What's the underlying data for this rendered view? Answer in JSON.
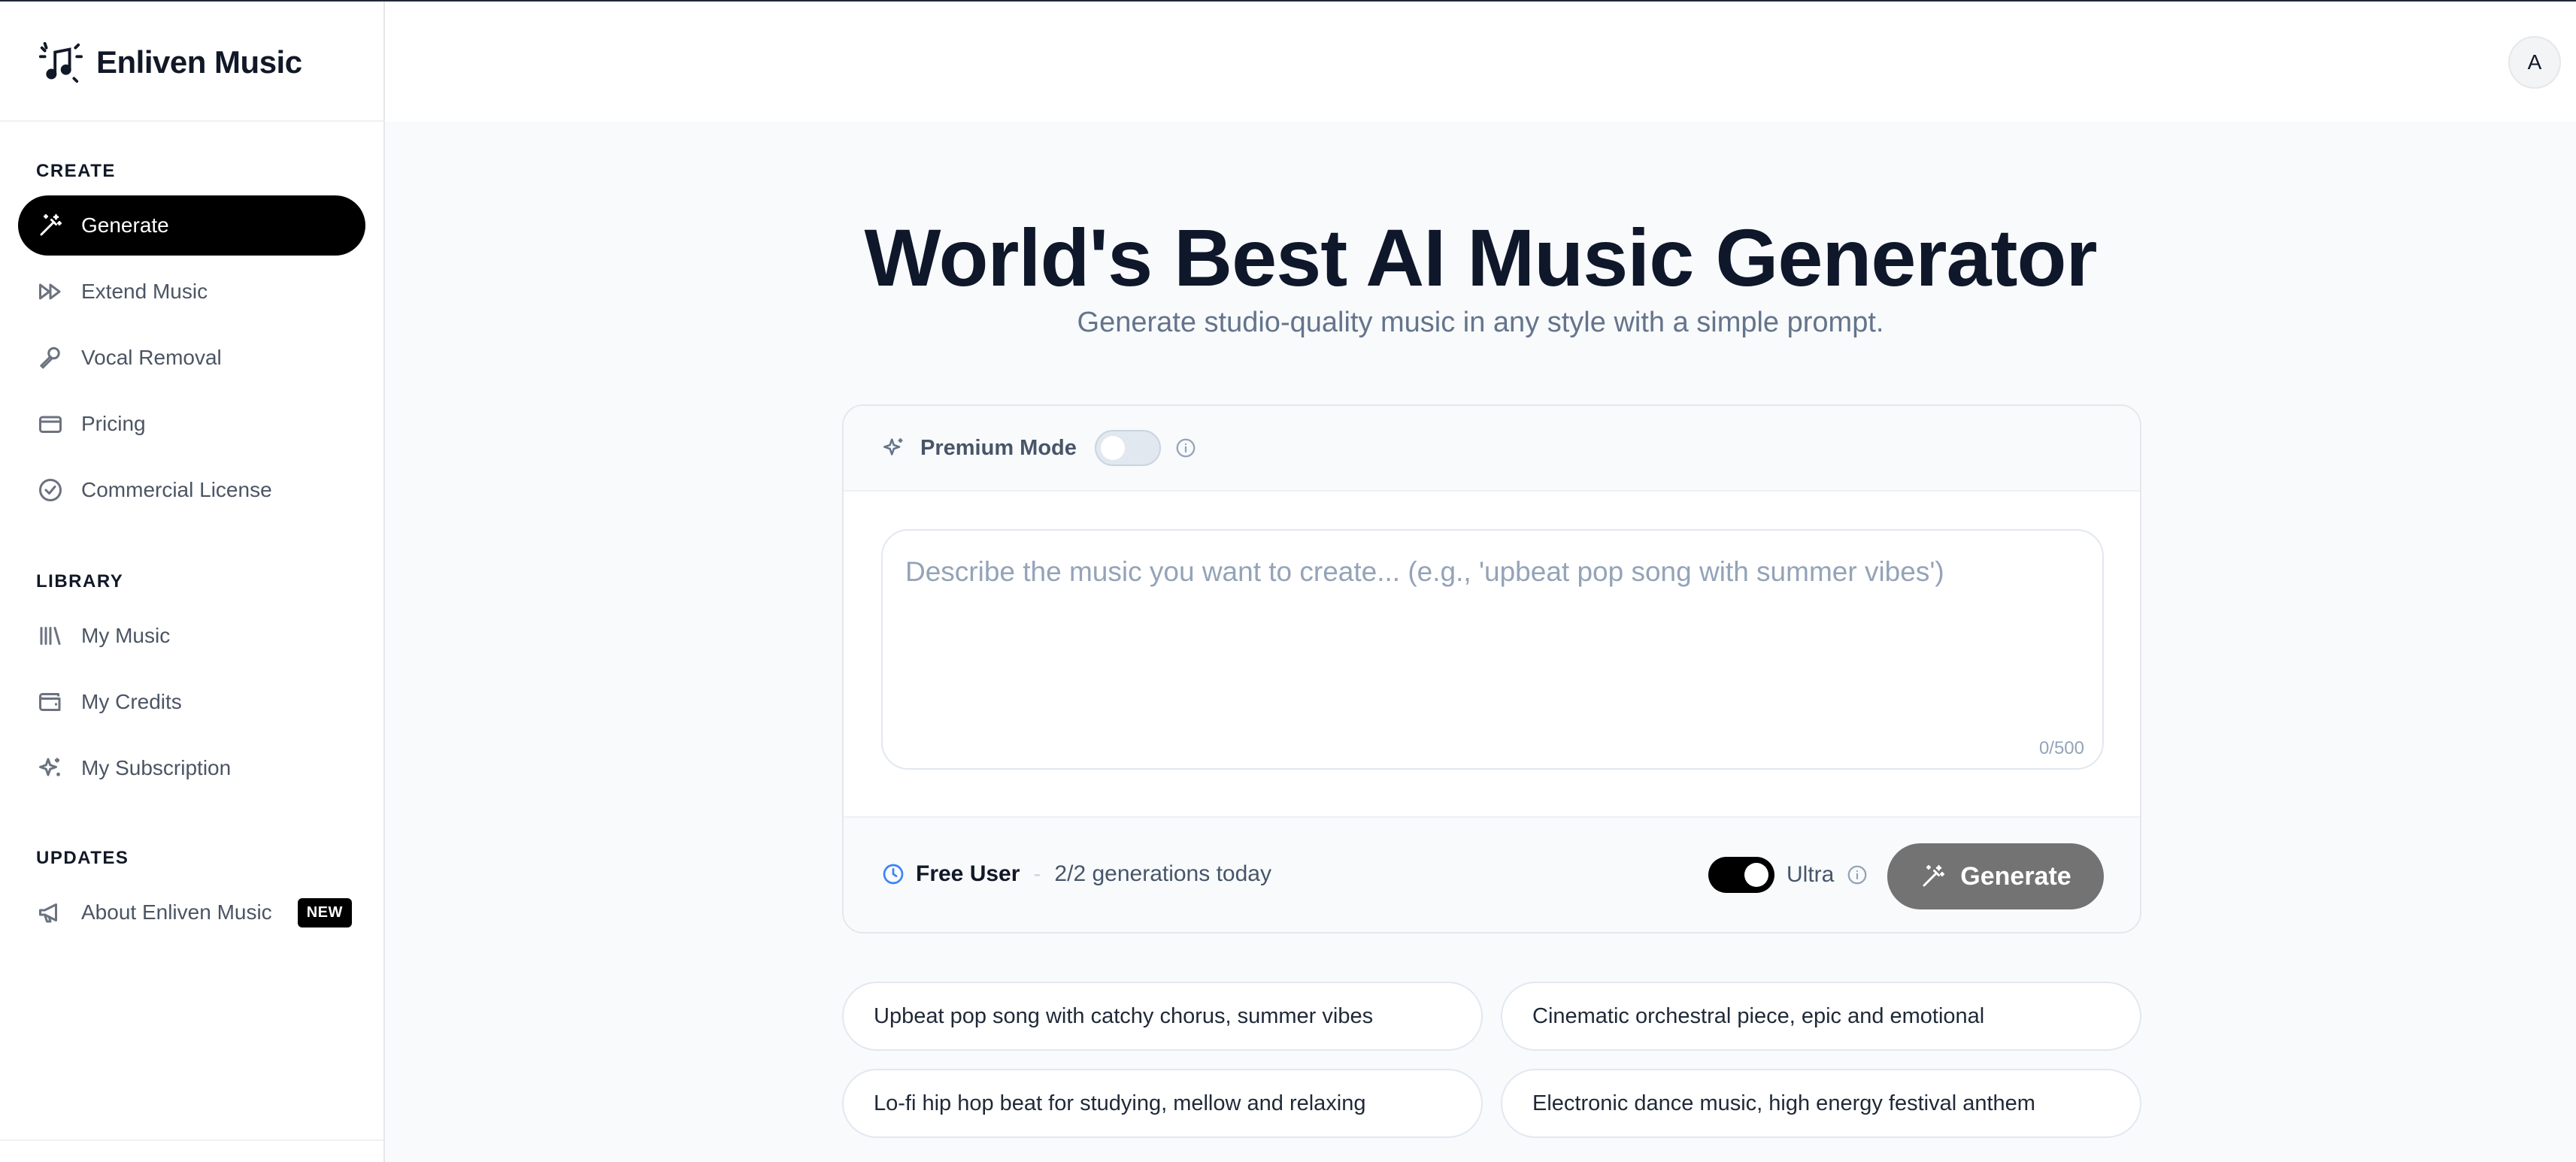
{
  "brand": {
    "name": "Enliven Music",
    "logo_icon": "music-notes-sparkle-icon"
  },
  "sidebar": {
    "sections": [
      {
        "label": "CREATE"
      },
      {
        "label": "LIBRARY"
      },
      {
        "label": "UPDATES"
      }
    ],
    "items": [
      {
        "label": "Generate",
        "icon": "magic-wand-icon",
        "active": true
      },
      {
        "label": "Extend Music",
        "icon": "fast-forward-icon"
      },
      {
        "label": "Vocal Removal",
        "icon": "microphone-icon"
      },
      {
        "label": "Pricing",
        "icon": "credit-card-icon"
      },
      {
        "label": "Commercial License",
        "icon": "badge-check-icon"
      },
      {
        "label": "My Music",
        "icon": "library-icon"
      },
      {
        "label": "My Credits",
        "icon": "wallet-icon"
      },
      {
        "label": "My Subscription",
        "icon": "sparkles-icon"
      },
      {
        "label": "About Enliven Music",
        "icon": "megaphone-icon",
        "badge": "NEW"
      }
    ]
  },
  "header": {
    "avatar_initial": "A"
  },
  "hero": {
    "title": "World's Best AI Music Generator",
    "subtitle": "Generate studio-quality music in any style with a simple prompt."
  },
  "generator": {
    "premium_label": "Premium Mode",
    "premium_enabled": false,
    "prompt_value": "",
    "prompt_placeholder": "Describe the music you want to create... (e.g., 'upbeat pop song with summer vibes')",
    "char_count": "0/500",
    "user_tier": "Free User",
    "separator": "-",
    "generations": "2/2 generations today",
    "ultra_label": "Ultra",
    "ultra_enabled": true,
    "generate_label": "Generate"
  },
  "suggestions": [
    "Upbeat pop song with catchy chorus, summer vibes",
    "Cinematic orchestral piece, epic and emotional",
    "Lo-fi hip hop beat for studying, mellow and relaxing",
    "Electronic dance music, high energy festival anthem"
  ],
  "colors": {
    "accent": "#000000",
    "button_disabled": "#737373",
    "muted_text": "#64748b",
    "clock_icon": "#3b82f6",
    "page_bg": "#f8fafc"
  }
}
